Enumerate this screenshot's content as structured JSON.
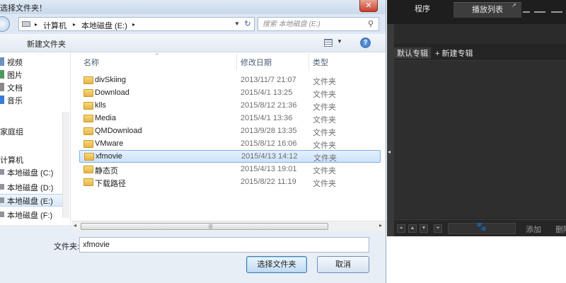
{
  "dialog": {
    "title": "选择文件夹！",
    "close_glyph": "✕",
    "address": {
      "crumbs": [
        "计算机",
        "本地磁盘 (E:)"
      ],
      "separator": "▸",
      "dropdown_glyph": "▼",
      "refresh_glyph": "↻"
    },
    "search": {
      "placeholder": "搜索 本地磁盘 (E:)",
      "icon": "search-icon"
    },
    "toolbar": {
      "new_folder_label": "新建文件夹",
      "view_dropdown_glyph": "▼",
      "help_glyph": "?"
    },
    "nav": {
      "items": [
        {
          "label": "视频",
          "color": "#6b8fbf"
        },
        {
          "label": "图片",
          "color": "#4f9a5a"
        },
        {
          "label": "文档",
          "color": "#8a8a8a"
        },
        {
          "label": "音乐",
          "color": "#3a7bd5"
        },
        {
          "label": "家庭组",
          "color": "#3b8dd3"
        },
        {
          "label": "计算机",
          "color": "#5c6f8a"
        },
        {
          "label": "本地磁盘 (C:)",
          "color": "#8d949c"
        },
        {
          "label": "本地磁盘 (D:)",
          "color": "#8d949c"
        },
        {
          "label": "本地磁盘 (E:)",
          "color": "#8d949c",
          "selected": true
        },
        {
          "label": "本地磁盘 (F:)",
          "color": "#8d949c"
        }
      ]
    },
    "columns": {
      "name": "名称",
      "date": "修改日期",
      "type": "类型",
      "sort_glyph": "^"
    },
    "files": [
      {
        "name": "divSkiing",
        "date": "2013/11/7 21:07",
        "type": "文件夹"
      },
      {
        "name": "Download",
        "date": "2015/4/1 13:25",
        "type": "文件夹"
      },
      {
        "name": "klls",
        "date": "2015/8/12 21:36",
        "type": "文件夹"
      },
      {
        "name": "Media",
        "date": "2015/4/1 13:36",
        "type": "文件夹"
      },
      {
        "name": "QMDownload",
        "date": "2013/9/28 13:35",
        "type": "文件夹"
      },
      {
        "name": "VMware",
        "date": "2015/8/12 16:06",
        "type": "文件夹"
      },
      {
        "name": "xfmovie",
        "date": "2015/4/13 14:12",
        "type": "文件夹",
        "selected": true
      },
      {
        "name": "静态页",
        "date": "2015/4/13 19:01",
        "type": "文件夹"
      },
      {
        "name": "下载路径",
        "date": "2015/8/22 11:19",
        "type": "文件夹"
      }
    ],
    "hscroll": {
      "left_glyph": "◂",
      "right_glyph": "▸",
      "grip_glyph": "|||"
    },
    "folder_label": "文件夹:",
    "folder_value": "xfmovie",
    "select_button": "选择文件夹",
    "cancel_button": "取消"
  },
  "player": {
    "tabs": [
      {
        "label": "程序"
      },
      {
        "label": "播放列表",
        "active": true
      }
    ],
    "tab_popout_glyph": "↗",
    "subtabs": [
      {
        "label": "默认专辑",
        "active": true
      },
      {
        "label": "+ 新建专辑"
      }
    ],
    "side_arrow_glyph": "◂",
    "bottom": {
      "buttons": [
        "⏶",
        "▲",
        "▼",
        "⏷"
      ],
      "paw_glyph": "🐾",
      "add_label": "添加",
      "delete_label": "删除"
    },
    "colors": {
      "background": "#2b2b2b",
      "topbar": "#1e1e1e"
    }
  }
}
